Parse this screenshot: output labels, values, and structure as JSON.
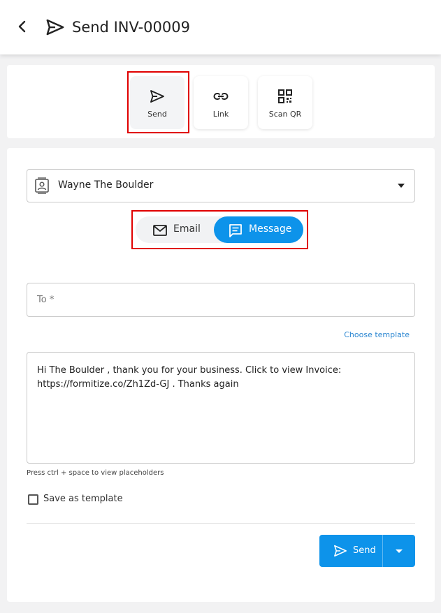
{
  "header": {
    "title": "Send INV-00009",
    "back_icon": "chevron-left-icon",
    "title_icon": "send-icon"
  },
  "share_modes": [
    {
      "label": "Send",
      "icon": "send-icon",
      "active": true
    },
    {
      "label": "Link",
      "icon": "link-icon",
      "active": false
    },
    {
      "label": "Scan QR",
      "icon": "qr-code-icon",
      "active": false
    }
  ],
  "contact": {
    "name": "Wayne The Boulder",
    "icon": "contact-card-icon"
  },
  "channel_toggle": {
    "email_label": "Email",
    "message_label": "Message",
    "selected": "Message"
  },
  "to_field": {
    "placeholder": "To *",
    "value": ""
  },
  "choose_template_label": "Choose template",
  "message": {
    "line1": "Hi  The Boulder , thank you for your business. Click to view Invoice:",
    "line2": "https://formitize.co/Zh1Zd-GJ . Thanks again"
  },
  "placeholder_hint": "Press ctrl + space to view placeholders",
  "save_as_template": {
    "label": "Save as template",
    "checked": false
  },
  "send_button": {
    "label": "Send"
  },
  "colors": {
    "accent": "#0d93ea",
    "highlight": "#e00000"
  }
}
